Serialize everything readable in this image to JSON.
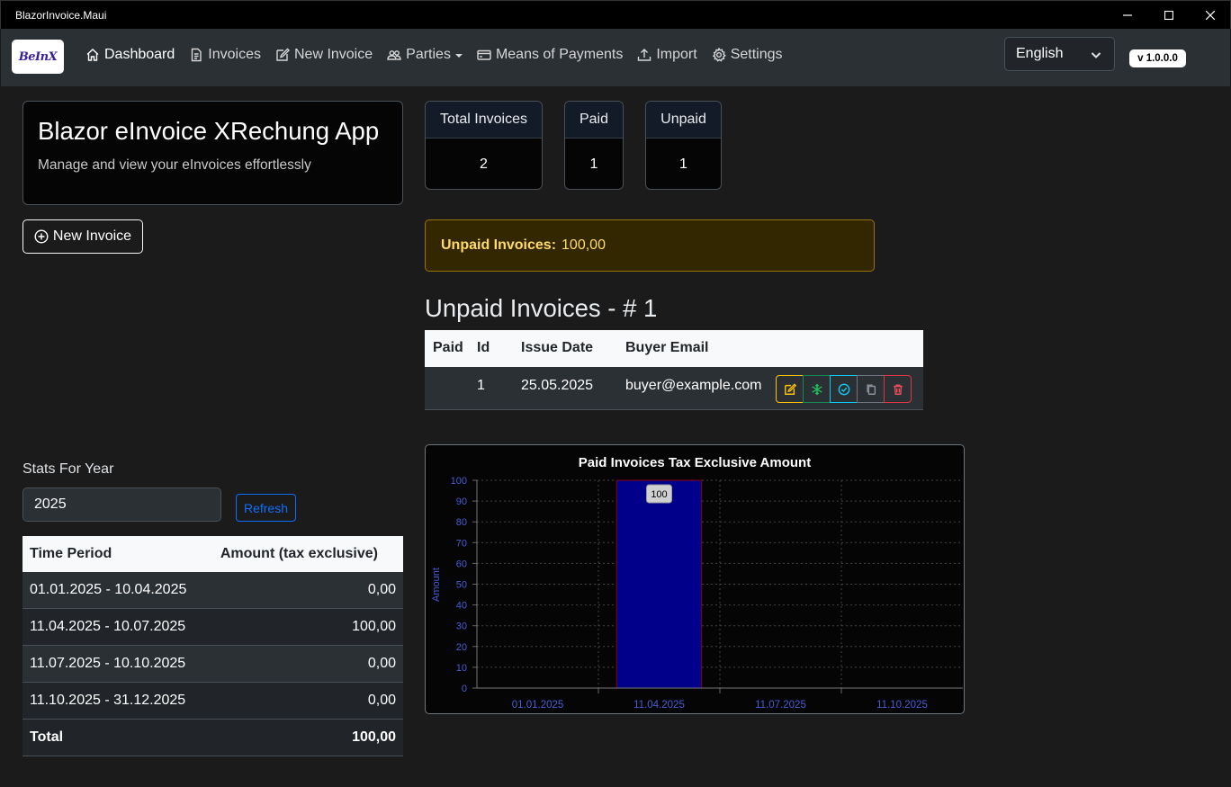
{
  "window": {
    "title": "BlazorInvoice.Maui"
  },
  "navbar": {
    "logo_text": "BeInX",
    "items": [
      {
        "label": "Dashboard",
        "icon": "house-icon"
      },
      {
        "label": "Invoices",
        "icon": "document-icon"
      },
      {
        "label": "New Invoice",
        "icon": "edit-icon"
      },
      {
        "label": "Parties",
        "icon": "people-icon"
      },
      {
        "label": "Means of Payments",
        "icon": "credit-card-icon"
      },
      {
        "label": "Import",
        "icon": "upload-icon"
      },
      {
        "label": "Settings",
        "icon": "gear-icon"
      }
    ],
    "language": "English",
    "version": "v 1.0.0.0"
  },
  "hero": {
    "title": "Blazor eInvoice XRechung App",
    "subtitle": "Manage and view your eInvoices effortlessly"
  },
  "new_invoice_button": "New Invoice",
  "stats": {
    "total": {
      "label": "Total Invoices",
      "value": "2"
    },
    "paid": {
      "label": "Paid",
      "value": "1"
    },
    "unpaid": {
      "label": "Unpaid",
      "value": "1"
    }
  },
  "alert": {
    "label": "Unpaid Invoices:",
    "value": "100,00"
  },
  "unpaid_section": {
    "title": "Unpaid Invoices - # 1",
    "columns": [
      "Paid",
      "Id",
      "Issue Date",
      "Buyer Email"
    ],
    "rows": [
      {
        "paid": "",
        "id": "1",
        "issue_date": "25.05.2025",
        "buyer_email": "buyer@example.com"
      }
    ]
  },
  "year_stats": {
    "label": "Stats For Year",
    "year": "2025",
    "refresh_label": "Refresh",
    "columns": [
      "Time Period",
      "Amount (tax exclusive)"
    ],
    "rows": [
      {
        "period": "01.01.2025 - 10.04.2025",
        "amount": "0,00"
      },
      {
        "period": "11.04.2025 - 10.07.2025",
        "amount": "100,00"
      },
      {
        "period": "11.07.2025 - 10.10.2025",
        "amount": "0,00"
      },
      {
        "period": "11.10.2025 - 31.12.2025",
        "amount": "0,00"
      }
    ],
    "total_label": "Total",
    "total_amount": "100,00"
  },
  "colors": {
    "bar_fill": "#00008b",
    "bar_stroke": "#8b0000",
    "axis_text": "#4a5cd6",
    "alert_text": "#ffda6a"
  },
  "chart_data": {
    "type": "bar",
    "title": "Paid Invoices Tax Exclusive Amount",
    "xlabel": "",
    "ylabel": "Amount",
    "categories": [
      "01.01.2025",
      "11.04.2025",
      "11.07.2025",
      "11.10.2025"
    ],
    "values": [
      0,
      100,
      0,
      0
    ],
    "data_labels": [
      "",
      "100",
      "",
      ""
    ],
    "ylim": [
      0,
      100
    ],
    "yticks": [
      0,
      10,
      20,
      30,
      40,
      50,
      60,
      70,
      80,
      90,
      100
    ],
    "grid": true,
    "legend": "none"
  }
}
